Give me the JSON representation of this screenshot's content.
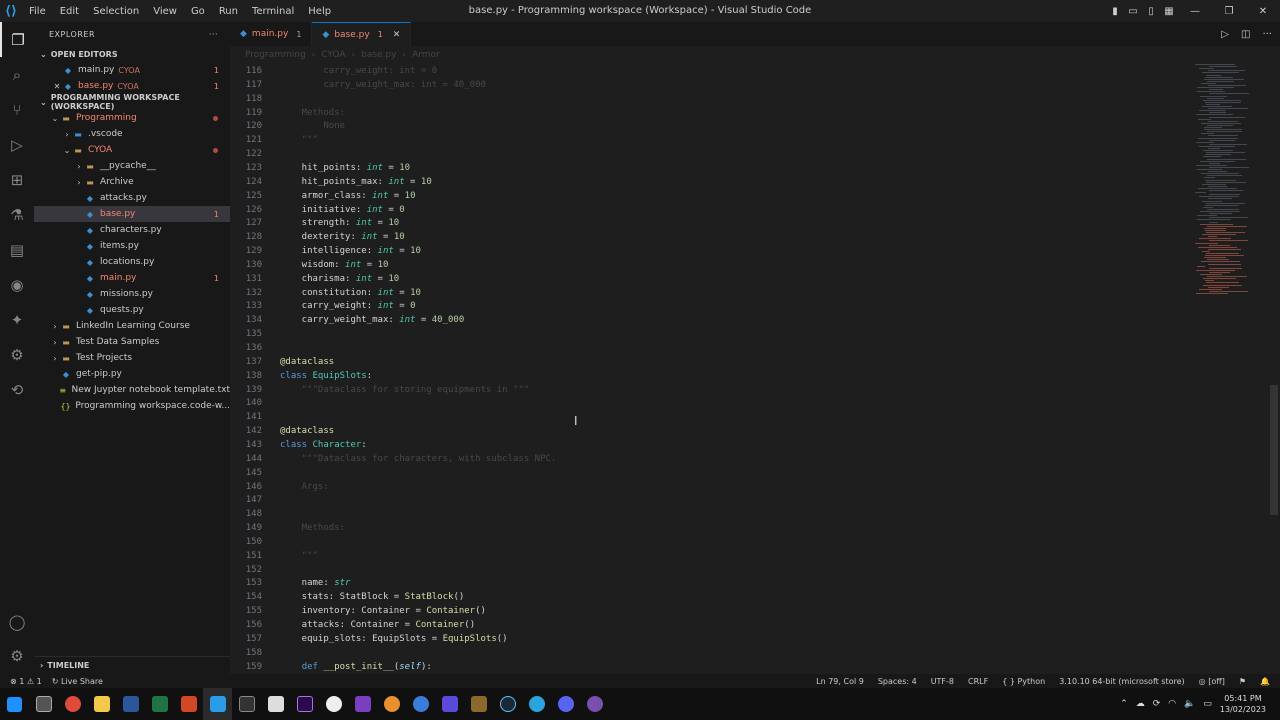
{
  "titlebar": {
    "menu": [
      "File",
      "Edit",
      "Selection",
      "View",
      "Go",
      "Run",
      "Terminal",
      "Help"
    ],
    "title": "base.py - Programming workspace (Workspace) - Visual Studio Code"
  },
  "explorer": {
    "header": "EXPLORER",
    "open_editors": "OPEN EDITORS",
    "workspace": "PROGRAMMING WORKSPACE (WORKSPACE)",
    "timeline": "TIMELINE",
    "open": [
      {
        "name": "main.py",
        "sub": "CYOA",
        "count": "1"
      },
      {
        "name": "base.py",
        "sub": "CYOA",
        "count": "1"
      }
    ],
    "tree": [
      {
        "label": "Programming",
        "kind": "folder",
        "open": true,
        "depth": 1,
        "err": true,
        "dot": true
      },
      {
        "label": ".vscode",
        "kind": "vscode",
        "depth": 2
      },
      {
        "label": "CYOA",
        "kind": "folder",
        "open": true,
        "depth": 2,
        "err": true,
        "dot": true
      },
      {
        "label": "__pycache__",
        "kind": "folder",
        "depth": 3
      },
      {
        "label": "Archive",
        "kind": "folder",
        "depth": 3
      },
      {
        "label": "attacks.py",
        "kind": "py",
        "depth": 3
      },
      {
        "label": "base.py",
        "kind": "py",
        "depth": 3,
        "err": true,
        "count": "1",
        "sel": true
      },
      {
        "label": "characters.py",
        "kind": "py",
        "depth": 3
      },
      {
        "label": "items.py",
        "kind": "py",
        "depth": 3
      },
      {
        "label": "locations.py",
        "kind": "py",
        "depth": 3
      },
      {
        "label": "main.py",
        "kind": "py",
        "depth": 3,
        "err": true,
        "count": "1"
      },
      {
        "label": "missions.py",
        "kind": "py",
        "depth": 3
      },
      {
        "label": "quests.py",
        "kind": "py",
        "depth": 3
      },
      {
        "label": "LinkedIn Learning Course",
        "kind": "folder",
        "depth": 1
      },
      {
        "label": "Test Data Samples",
        "kind": "folder",
        "depth": 1
      },
      {
        "label": "Test Projects",
        "kind": "folder",
        "depth": 1
      },
      {
        "label": "get-pip.py",
        "kind": "py",
        "depth": 1,
        "leaf": true
      },
      {
        "label": "New Juypter notebook template.txt",
        "kind": "txt",
        "depth": 1,
        "leaf": true
      },
      {
        "label": "Programming workspace.code-w...",
        "kind": "json",
        "depth": 1,
        "leaf": true
      }
    ]
  },
  "tabs": [
    {
      "name": "main.py",
      "count": "1"
    },
    {
      "name": "base.py",
      "count": "1",
      "active": true
    }
  ],
  "breadcrumb": [
    "Programming",
    "CYOA",
    "base.py",
    "Armor"
  ],
  "code": [
    {
      "n": "116",
      "t": "        carry_weight: int = 0",
      "f": true
    },
    {
      "n": "117",
      "t": "        carry_weight_max: int = 40_000",
      "f": true
    },
    {
      "n": "118",
      "t": ""
    },
    {
      "n": "119",
      "t": "    Methods:",
      "f": true
    },
    {
      "n": "120",
      "t": "        None",
      "f": true
    },
    {
      "n": "121",
      "t": "    \"\"\"",
      "f": true
    },
    {
      "n": "122",
      "t": ""
    },
    {
      "n": "123",
      "a": "hit_points",
      "b": "int",
      "c": "10"
    },
    {
      "n": "124",
      "a": "hit_points_max",
      "b": "int",
      "c": "10"
    },
    {
      "n": "125",
      "a": "armor_class",
      "b": "int",
      "c": "10"
    },
    {
      "n": "126",
      "a": "initiative",
      "b": "int",
      "c": "0"
    },
    {
      "n": "127",
      "a": "strength",
      "b": "int",
      "c": "10"
    },
    {
      "n": "128",
      "a": "dexterity",
      "b": "int",
      "c": "10"
    },
    {
      "n": "129",
      "a": "intelligence",
      "b": "int",
      "c": "10"
    },
    {
      "n": "130",
      "a": "wisdom",
      "b": "int",
      "c": "10"
    },
    {
      "n": "131",
      "a": "charisma",
      "b": "int",
      "c": "10"
    },
    {
      "n": "132",
      "a": "constitution",
      "b": "int",
      "c": "10"
    },
    {
      "n": "133",
      "a": "carry_weight",
      "b": "int",
      "c": "0"
    },
    {
      "n": "134",
      "a": "carry_weight_max",
      "b": "int",
      "c": "40_000"
    },
    {
      "n": "135",
      "t": ""
    },
    {
      "n": "136",
      "t": ""
    },
    {
      "n": "137",
      "dec": "@dataclass"
    },
    {
      "n": "138",
      "cls": "EquipSlots"
    },
    {
      "n": "139",
      "t": "    \"\"\"Dataclass for storing equipments in \"\"\"",
      "f": true
    },
    {
      "n": "140",
      "t": ""
    },
    {
      "n": "141",
      "t": ""
    },
    {
      "n": "142",
      "dec": "@dataclass"
    },
    {
      "n": "143",
      "cls": "Character"
    },
    {
      "n": "144",
      "t": "    \"\"\"Dataclass for characters, with subclass NPC.",
      "f": true
    },
    {
      "n": "145",
      "t": ""
    },
    {
      "n": "146",
      "t": "    Args:",
      "f": true
    },
    {
      "n": "147",
      "t": ""
    },
    {
      "n": "148",
      "t": ""
    },
    {
      "n": "149",
      "t": "    Methods:",
      "f": true
    },
    {
      "n": "150",
      "t": ""
    },
    {
      "n": "151",
      "t": "    \"\"\"",
      "f": true
    },
    {
      "n": "152",
      "t": ""
    },
    {
      "n": "153",
      "a": "name",
      "b": "str"
    },
    {
      "n": "154",
      "a": "stats",
      "b": "StatBlock",
      "c": "StatBlock()",
      "obj": true
    },
    {
      "n": "155",
      "a": "inventory",
      "b": "Container",
      "c": "Container()",
      "obj": true
    },
    {
      "n": "156",
      "a": "attacks",
      "b": "Container",
      "c": "Container()",
      "obj": true
    },
    {
      "n": "157",
      "a": "equip_slots",
      "b": "EquipSlots",
      "c": "EquipSlots()",
      "obj": true
    },
    {
      "n": "158",
      "t": ""
    },
    {
      "n": "159",
      "def": "__post_init__"
    }
  ],
  "status": {
    "errors": "1",
    "warnings": "1",
    "live": "Live Share",
    "pos": "Ln 79, Col 9",
    "spaces": "Spaces: 4",
    "enc": "UTF-8",
    "eol": "CRLF",
    "lang": "Python",
    "interp": "3.10.10 64-bit (microsoft store)",
    "off": "[off]"
  },
  "clock": {
    "time": "05:41 PM",
    "date": "13/02/2023"
  }
}
